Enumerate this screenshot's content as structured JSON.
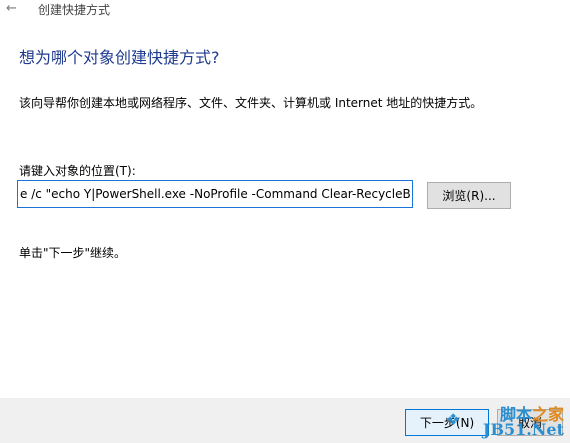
{
  "window": {
    "title": "创建快捷方式",
    "back_icon": "back-arrow-icon"
  },
  "content": {
    "heading": "想为哪个对象创建快捷方式?",
    "description": "该向导帮你创建本地或网络程序、文件、文件夹、计算机或 Internet 地址的快捷方式。",
    "location_label": "请键入对象的位置(T):",
    "location_value": "e /c \"echo Y|PowerShell.exe -NoProfile -Command Clear-RecycleBin\"",
    "browse_label": "浏览(R)...",
    "continue_hint": "单击\"下一步\"继续。"
  },
  "footer": {
    "next_label": "下一步(N)",
    "cancel_label": "取消"
  },
  "watermark": {
    "site_name_prefix": "脚本",
    "site_name_accent": "之家",
    "site_domain": "JB51.Net"
  },
  "colors": {
    "heading": "#1f3b8f",
    "input_border": "#1a73d9",
    "footer_bg": "#f0f0f0",
    "watermark_blue": "#2a8fd0",
    "watermark_orange": "#e08a1e"
  }
}
